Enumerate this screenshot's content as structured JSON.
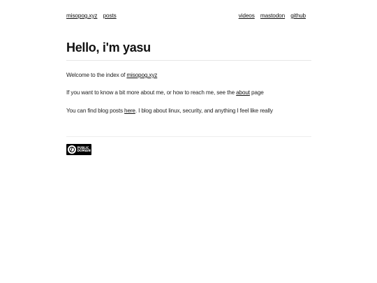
{
  "nav": {
    "left": [
      {
        "label": "misopog.xyz"
      },
      {
        "label": "posts"
      }
    ],
    "right": [
      {
        "label": "videos"
      },
      {
        "label": "mastodon"
      },
      {
        "label": "github"
      }
    ]
  },
  "main": {
    "title": "Hello, i'm yasu",
    "p1": {
      "before": "Welcome to the index of ",
      "link": "misopog.xyz"
    },
    "p2": {
      "before": "If you want to know a bit more about me, or how to reach me, see the ",
      "link": "about",
      "after": " page"
    },
    "p3": {
      "before": "You can find blog posts ",
      "link": "here",
      "after": ". I blog about linux, security, and anything I feel like really"
    }
  },
  "footer": {
    "badge": {
      "line1": "PUBLIC",
      "line2": "DOMAIN",
      "icon": "public-domain-icon"
    }
  }
}
